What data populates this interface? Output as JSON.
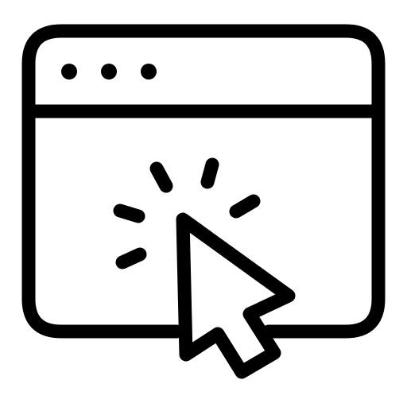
{
  "icon": {
    "name": "browser-window-click-icon",
    "description_tokens": [
      "browser-window-icon",
      "cursor-click-icon"
    ],
    "colors": {
      "stroke": "#000000",
      "background": "#ffffff"
    }
  }
}
